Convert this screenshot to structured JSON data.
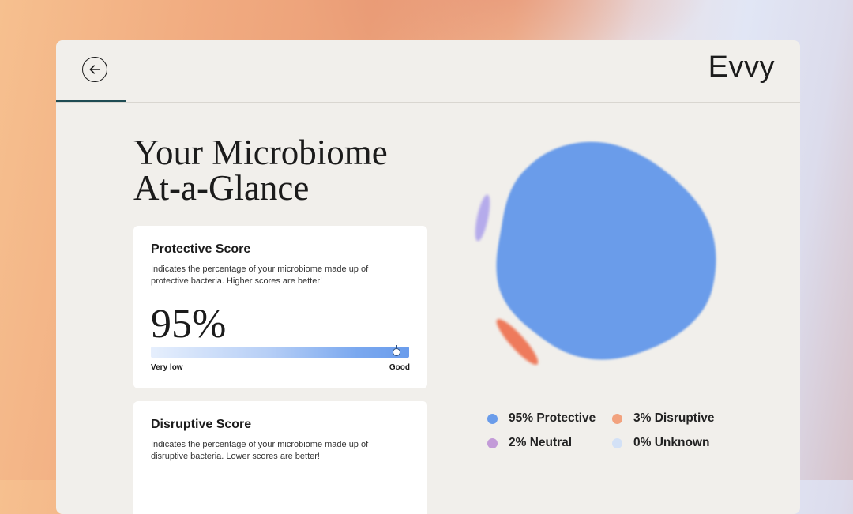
{
  "brand": {
    "logo_text": "Evvy"
  },
  "header": {
    "back_icon": "arrow-left-icon"
  },
  "title": {
    "line1": "Your Microbiome",
    "line2": "At-a-Glance"
  },
  "protective": {
    "heading": "Protective Score",
    "description": "Indicates the percentage of your microbiome made up of protective bacteria. Higher scores are better!",
    "value_text": "95%",
    "value": 0.95,
    "scale_low": "Very low",
    "scale_high": "Good"
  },
  "disruptive": {
    "heading": "Disruptive Score",
    "description": "Indicates the percentage of your microbiome made up of disruptive bacteria. Lower scores are better!"
  },
  "legend": [
    {
      "label": "95% Protective",
      "color": "#6a9cea"
    },
    {
      "label": "3% Disruptive",
      "color": "#f2a27e"
    },
    {
      "label": "2% Neutral",
      "color": "#c39bd8"
    },
    {
      "label": "0% Unknown",
      "color": "#d3e1f6"
    }
  ],
  "colors": {
    "protective": "#6a9cea",
    "disruptive": "#ee7a5c",
    "neutral": "#b5abeb",
    "accent": "#1f4c53"
  }
}
